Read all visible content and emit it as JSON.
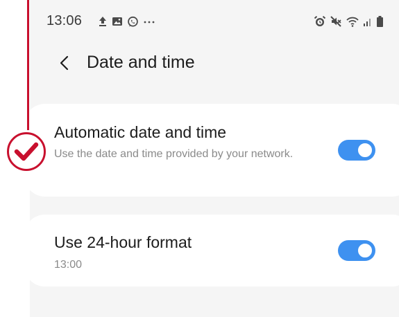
{
  "status_bar": {
    "time": "13:06",
    "left_icons": [
      "upload-icon",
      "gallery-icon",
      "whatsapp-icon",
      "more-dots-icon"
    ],
    "right_icons": [
      "alarm-icon",
      "mute-icon",
      "wifi-icon",
      "signal-icon",
      "battery-icon"
    ]
  },
  "header": {
    "back_icon": "chevron-left-icon",
    "title": "Date and time"
  },
  "settings": {
    "automatic": {
      "title": "Automatic date and time",
      "subtitle": "Use the date and time provided by your network.",
      "enabled": true
    },
    "hour_format": {
      "title": "Use 24-hour format",
      "subtitle": "13:00",
      "enabled": true
    }
  },
  "annotation": {
    "marker_icon": "checkmark-icon",
    "color": "#c8102e"
  },
  "colors": {
    "accent": "#3e91f0",
    "background": "#f5f5f5",
    "card": "#ffffff"
  }
}
